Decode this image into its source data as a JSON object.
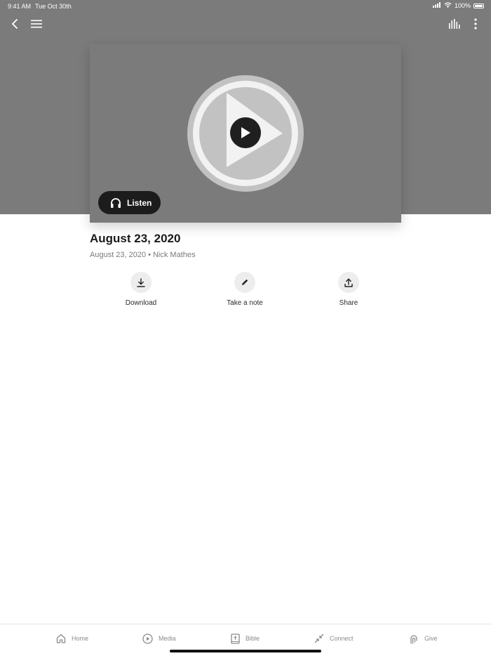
{
  "status_bar": {
    "time": "9:41 AM",
    "date": "Tue Oct 30th",
    "battery": "100%"
  },
  "nav": {
    "back_icon": "chevron-left-icon",
    "menu_icon": "hamburger-menu-icon",
    "audio_icon": "equalizer-icon",
    "more_icon": "vertical-ellipsis-icon"
  },
  "media": {
    "listen_label": "Listen",
    "listen_icon": "headphones-icon",
    "play_icon": "play-icon"
  },
  "sermon": {
    "title": "August 23, 2020",
    "date": "August 23, 2020",
    "separator": "•",
    "speaker": "Nick Mathes"
  },
  "actions": [
    {
      "label": "Download",
      "icon": "download-icon"
    },
    {
      "label": "Take a note",
      "icon": "pencil-icon"
    },
    {
      "label": "Share",
      "icon": "share-icon"
    }
  ],
  "tabs": [
    {
      "label": "Home",
      "icon": "home-icon"
    },
    {
      "label": "Media",
      "icon": "play-circle-icon"
    },
    {
      "label": "Bible",
      "icon": "bible-icon"
    },
    {
      "label": "Connect",
      "icon": "connect-arrows-icon"
    },
    {
      "label": "Give",
      "icon": "give-hand-icon"
    }
  ],
  "colors": {
    "hero_background": "#7b7b7b",
    "listen_button": "#1c1c1c",
    "action_circle": "#ededed",
    "tab_text": "#8a8a8a"
  }
}
